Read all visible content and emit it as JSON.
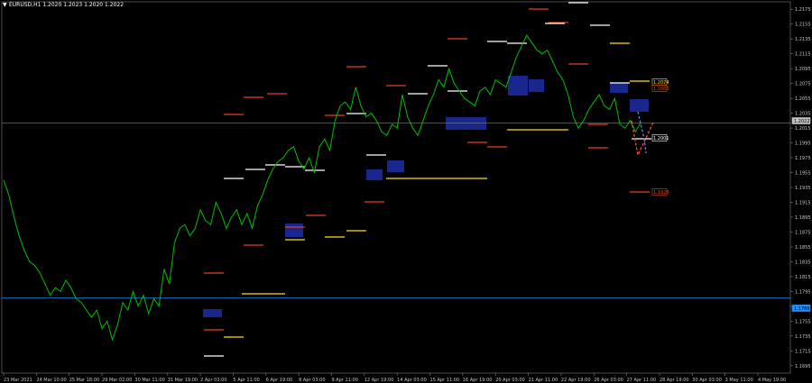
{
  "header": {
    "symbol_info": "EURUSD,H1  1.2020 1.2023 1.2020 1.2022",
    "menu_icon": "triangle-down-icon"
  },
  "colors": {
    "background": "#000000",
    "price_line": "#00c000",
    "axis_text": "#c8c8c8",
    "grid_frame": "#808080",
    "white_level": "#ffffff",
    "red_level": "#e8401c",
    "yellow_level": "#ffe000",
    "zone_fill": "#1c2a9c",
    "current_price_line": "#7f7f7f",
    "blue_line": "#1e90ff",
    "current_label_bg": "#c0c0c0"
  },
  "chart_data": {
    "type": "line",
    "title": "EURUSD,H1",
    "ylim": [
      1.1685,
      1.2185
    ],
    "y_ticks": [
      "1.2175",
      "1.2155",
      "1.2135",
      "1.2115",
      "1.2095",
      "1.2075",
      "1.2055",
      "1.2035",
      "1.2015",
      "1.1995",
      "1.1975",
      "1.1955",
      "1.1935",
      "1.1915",
      "1.1895",
      "1.1875",
      "1.1855",
      "1.1835",
      "1.1815",
      "1.1795",
      "1.1775",
      "1.1755",
      "1.1735",
      "1.1715",
      "1.1695"
    ],
    "x_ticks": [
      "23 Mar 2021",
      "24 Mar 10:00",
      "25 Mar 18:00",
      "29 Mar 02:00",
      "30 Mar 11:00",
      "31 Mar 19:00",
      "2 Apr 03:00",
      "5 Apr 11:00",
      "6 Apr 19:00",
      "8 Apr 03:00",
      "9 Apr 11:00",
      "12 Apr 19:00",
      "14 Apr 03:00",
      "15 Apr 11:00",
      "16 Apr 19:00",
      "20 Apr 03:00",
      "21 Apr 11:00",
      "22 Apr 19:00",
      "26 Apr 03:00",
      "27 Apr 11:00",
      "28 Apr 19:00",
      "30 Apr 03:00",
      "3 May 11:00",
      "4 May 19:00"
    ],
    "series": [
      {
        "values": [
          1.1945,
          1.1925,
          1.1895,
          1.187,
          1.185,
          1.1835,
          1.183,
          1.182,
          1.1805,
          1.179,
          1.18,
          1.1795,
          1.181,
          1.18,
          1.1785,
          1.178,
          1.177,
          1.176,
          1.177,
          1.1745,
          1.1755,
          1.173,
          1.175,
          1.178,
          1.177,
          1.1795,
          1.1775,
          1.179,
          1.1765,
          1.1785,
          1.1775,
          1.1825,
          1.1805,
          1.186,
          1.188,
          1.1885,
          1.187,
          1.188,
          1.1905,
          1.189,
          1.1885,
          1.1915,
          1.19,
          1.188,
          1.1895,
          1.1905,
          1.1885,
          1.19,
          1.188,
          1.191,
          1.1925,
          1.1945,
          1.196,
          1.197,
          1.1975,
          1.1985,
          1.199,
          1.197,
          1.196,
          1.1975,
          1.1955,
          1.199,
          1.2,
          1.1985,
          1.2025,
          1.2045,
          1.205,
          1.204,
          1.207,
          1.2045,
          1.203,
          1.2035,
          1.2025,
          1.201,
          1.2005,
          1.202,
          1.2015,
          1.206,
          1.203,
          1.2015,
          1.2005,
          1.2025,
          1.2045,
          1.206,
          1.208,
          1.207,
          1.2095,
          1.2075,
          1.2065,
          1.2055,
          1.205,
          1.2045,
          1.2065,
          1.207,
          1.206,
          1.208,
          1.2075,
          1.207,
          1.209,
          1.211,
          1.2125,
          1.214,
          1.213,
          1.212,
          1.2115,
          1.212,
          1.2105,
          1.209,
          1.208,
          1.206,
          1.203,
          1.2015,
          1.2025,
          1.204,
          1.205,
          1.206,
          1.2045,
          1.204,
          1.2055,
          1.202,
          1.2015,
          1.2025,
          1.201,
          1.2022
        ]
      }
    ],
    "level_labels": [
      {
        "text": "1.2074",
        "color": "yellow"
      },
      {
        "text": "1.2066",
        "color": "red"
      },
      {
        "text": "1.2022",
        "color": "current"
      },
      {
        "text": "1.2001",
        "color": "white"
      },
      {
        "text": "1.1928",
        "color": "red"
      },
      {
        "text": "1.1786",
        "color": "blue"
      }
    ],
    "horizontal_levels": [
      {
        "x0": "24 Mar 10:00",
        "x1": "24 Mar 10:00",
        "y": 1.1785,
        "kind": "zone"
      }
    ],
    "grid": false,
    "legend": "none"
  }
}
